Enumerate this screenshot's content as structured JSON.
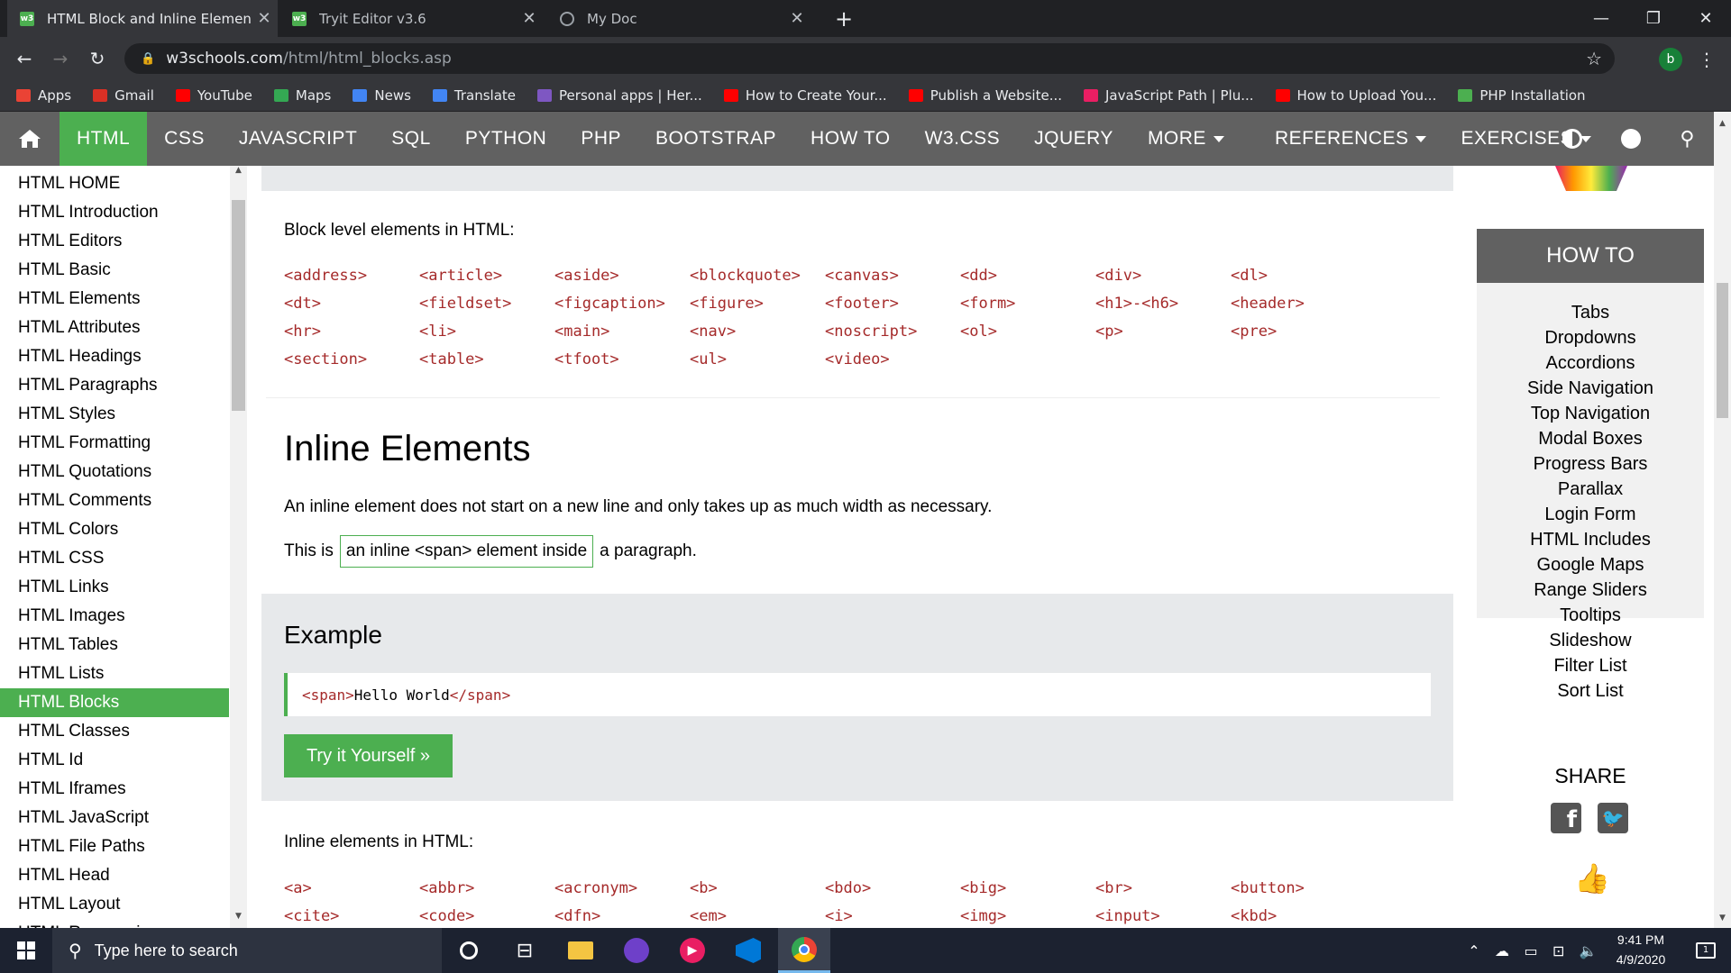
{
  "browser": {
    "tabs": [
      {
        "title": "HTML Block and Inline Elements",
        "active": true,
        "icon": "w3schools-icon"
      },
      {
        "title": "Tryit Editor v3.6",
        "active": false,
        "icon": "w3schools-icon"
      },
      {
        "title": "My Doc",
        "active": false,
        "icon": "globe-icon"
      }
    ],
    "url_host": "w3schools.com",
    "url_path": "/html/html_blocks.asp",
    "profile_initial": "b",
    "bookmarks": [
      {
        "label": "Apps",
        "icon": "apps-grid-icon",
        "color": "#ea4335"
      },
      {
        "label": "Gmail",
        "icon": "gmail-icon",
        "color": "#d93025"
      },
      {
        "label": "YouTube",
        "icon": "youtube-icon",
        "color": "#ff0000"
      },
      {
        "label": "Maps",
        "icon": "maps-icon",
        "color": "#34a853"
      },
      {
        "label": "News",
        "icon": "news-icon",
        "color": "#4285f4"
      },
      {
        "label": "Translate",
        "icon": "translate-icon",
        "color": "#4285f4"
      },
      {
        "label": "Personal apps | Her...",
        "icon": "heroku-icon",
        "color": "#7e57c2"
      },
      {
        "label": "How to Create Your...",
        "icon": "youtube-icon",
        "color": "#ff0000"
      },
      {
        "label": "Publish a Website...",
        "icon": "youtube-icon",
        "color": "#ff0000"
      },
      {
        "label": "JavaScript Path | Plu...",
        "icon": "pluralsight-icon",
        "color": "#e91e63"
      },
      {
        "label": "How to Upload You...",
        "icon": "youtube-icon",
        "color": "#ff0000"
      },
      {
        "label": "PHP Installation",
        "icon": "w3schools-icon",
        "color": "#4caf50"
      }
    ]
  },
  "topnav": {
    "items": [
      "HTML",
      "CSS",
      "JAVASCRIPT",
      "SQL",
      "PYTHON",
      "PHP",
      "BOOTSTRAP",
      "HOW TO",
      "W3.CSS",
      "JQUERY",
      "MORE",
      "REFERENCES",
      "EXERCISES"
    ],
    "active": "HTML"
  },
  "sidebar": {
    "items": [
      "HTML HOME",
      "HTML Introduction",
      "HTML Editors",
      "HTML Basic",
      "HTML Elements",
      "HTML Attributes",
      "HTML Headings",
      "HTML Paragraphs",
      "HTML Styles",
      "HTML Formatting",
      "HTML Quotations",
      "HTML Comments",
      "HTML Colors",
      "HTML CSS",
      "HTML Links",
      "HTML Images",
      "HTML Tables",
      "HTML Lists",
      "HTML Blocks",
      "HTML Classes",
      "HTML Id",
      "HTML Iframes",
      "HTML JavaScript",
      "HTML File Paths",
      "HTML Head",
      "HTML Layout",
      "HTML Responsive"
    ],
    "active": "HTML Blocks"
  },
  "main": {
    "block_heading": "Block level elements in HTML:",
    "block_tags": [
      [
        "<address>",
        "<article>",
        "<aside>",
        "<blockquote>",
        "<canvas>",
        "<dd>",
        "<div>",
        "<dl>"
      ],
      [
        "<dt>",
        "<fieldset>",
        "<figcaption>",
        "<figure>",
        "<footer>",
        "<form>",
        "<h1>-<h6>",
        "<header>"
      ],
      [
        "<hr>",
        "<li>",
        "<main>",
        "<nav>",
        "<noscript>",
        "<ol>",
        "<p>",
        "<pre>"
      ],
      [
        "<section>",
        "<table>",
        "<tfoot>",
        "<ul>",
        "<video>"
      ]
    ],
    "inline_title": "Inline Elements",
    "inline_desc": "An inline element does not start on a new line and only takes up as much width as necessary.",
    "para_prefix": "This is",
    "para_span": "an inline <span> element inside",
    "para_suffix": "a paragraph.",
    "example_title": "Example",
    "example_code_open": "<span>",
    "example_code_text": "Hello World",
    "example_code_close": "</span>",
    "try_button": "Try it Yourself »",
    "inline_heading": "Inline elements in HTML:",
    "inline_tags": [
      [
        "<a>",
        "<abbr>",
        "<acronym>",
        "<b>",
        "<bdo>",
        "<big>",
        "<br>",
        "<button>"
      ],
      [
        "<cite>",
        "<code>",
        "<dfn>",
        "<em>",
        "<i>",
        "<img>",
        "<input>",
        "<kbd>"
      ]
    ],
    "accent_color": "#4caf50",
    "tag_color": "#a52a2a"
  },
  "howto": {
    "header": "HOW TO",
    "items": [
      "Tabs",
      "Dropdowns",
      "Accordions",
      "Side Navigation",
      "Top Navigation",
      "Modal Boxes",
      "Progress Bars",
      "Parallax",
      "Login Form",
      "HTML Includes",
      "Google Maps",
      "Range Sliders",
      "Tooltips",
      "Slideshow",
      "Filter List",
      "Sort List"
    ],
    "share_label": "SHARE"
  },
  "taskbar": {
    "search_placeholder": "Type here to search",
    "time": "9:41 PM",
    "date": "4/9/2020",
    "notification_count": "1"
  }
}
